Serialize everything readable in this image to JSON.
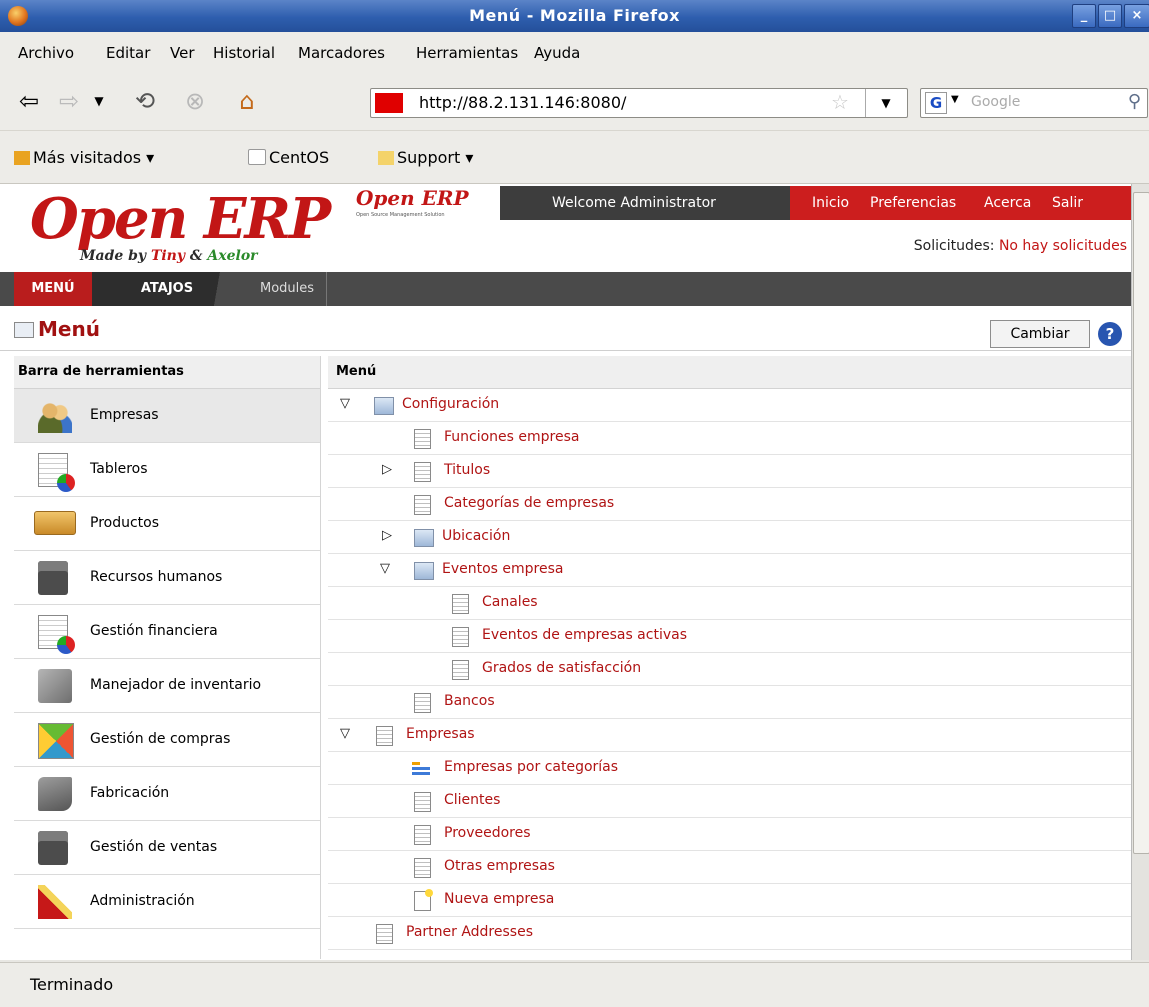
{
  "window": {
    "title": "Menú - Mozilla Firefox"
  },
  "menubar": [
    "Archivo",
    "Editar",
    "Ver",
    "Historial",
    "Marcadores",
    "Herramientas",
    "Ayuda"
  ],
  "navigation": {
    "url": "http://88.2.131.146:8080/",
    "search_placeholder": "Google"
  },
  "bookmarks": [
    "Más visitados ▾",
    "CentOS",
    "Support ▾"
  ],
  "header": {
    "welcome": "Welcome Administrator",
    "nav_links": [
      "Inicio",
      "Preferencias",
      "Acerca",
      "Salir"
    ],
    "requests_label": "Solicitudes:",
    "requests_value": "No hay solicitudes",
    "logo_text": "Open ERP",
    "logo_tagline_made": "Made by",
    "logo_tagline_tiny": "Tiny",
    "logo_tagline_amp": "&",
    "logo_tagline_axelor": "Axelor",
    "small_logo": "Open ERP",
    "small_logo_sub": "Open Source Management Solution"
  },
  "tabs": [
    "MENÚ",
    "ATAJOS",
    "Modules"
  ],
  "page": {
    "title": "Menú",
    "change_button": "Cambiar",
    "help": "?"
  },
  "sidebar": {
    "header": "Barra de herramientas",
    "items": [
      {
        "label": "Empresas",
        "icon": "companies-icon"
      },
      {
        "label": "Tableros",
        "icon": "dashboards-icon"
      },
      {
        "label": "Productos",
        "icon": "products-icon"
      },
      {
        "label": "Recursos humanos",
        "icon": "hr-icon"
      },
      {
        "label": "Gestión financiera",
        "icon": "finance-icon"
      },
      {
        "label": "Manejador de inventario",
        "icon": "inventory-icon"
      },
      {
        "label": "Gestión de compras",
        "icon": "purchases-icon"
      },
      {
        "label": "Fabricación",
        "icon": "manufacturing-icon"
      },
      {
        "label": "Gestión de ventas",
        "icon": "sales-icon"
      },
      {
        "label": "Administración",
        "icon": "administration-icon"
      }
    ]
  },
  "tree": {
    "header": "Menú",
    "rows": [
      {
        "label": "Configuración",
        "level": 0,
        "toggle": "expanded",
        "icon": "folder"
      },
      {
        "label": "Funciones empresa",
        "level": 1,
        "toggle": "none",
        "icon": "document"
      },
      {
        "label": "Titulos",
        "level": 1,
        "toggle": "collapsed",
        "icon": "document"
      },
      {
        "label": "Categorías de empresas",
        "level": 1,
        "toggle": "none",
        "icon": "document"
      },
      {
        "label": "Ubicación",
        "level": 1,
        "toggle": "collapsed",
        "icon": "folder"
      },
      {
        "label": "Eventos empresa",
        "level": 1,
        "toggle": "expanded",
        "icon": "folder"
      },
      {
        "label": "Canales",
        "level": 2,
        "toggle": "none",
        "icon": "document"
      },
      {
        "label": "Eventos de empresas activas",
        "level": 2,
        "toggle": "none",
        "icon": "document"
      },
      {
        "label": "Grados de satisfacción",
        "level": 2,
        "toggle": "none",
        "icon": "document"
      },
      {
        "label": "Bancos",
        "level": 1,
        "toggle": "none",
        "icon": "document"
      },
      {
        "label": "Empresas",
        "level": 0,
        "toggle": "expanded",
        "icon": "document"
      },
      {
        "label": "Empresas por categorías",
        "level": 1,
        "toggle": "none",
        "icon": "tree"
      },
      {
        "label": "Clientes",
        "level": 1,
        "toggle": "none",
        "icon": "document"
      },
      {
        "label": "Proveedores",
        "level": 1,
        "toggle": "none",
        "icon": "document"
      },
      {
        "label": "Otras empresas",
        "level": 1,
        "toggle": "none",
        "icon": "document"
      },
      {
        "label": "Nueva empresa",
        "level": 1,
        "toggle": "none",
        "icon": "new"
      },
      {
        "label": "Partner Addresses",
        "level": 0,
        "toggle": "none",
        "icon": "document"
      }
    ]
  },
  "status": "Terminado"
}
